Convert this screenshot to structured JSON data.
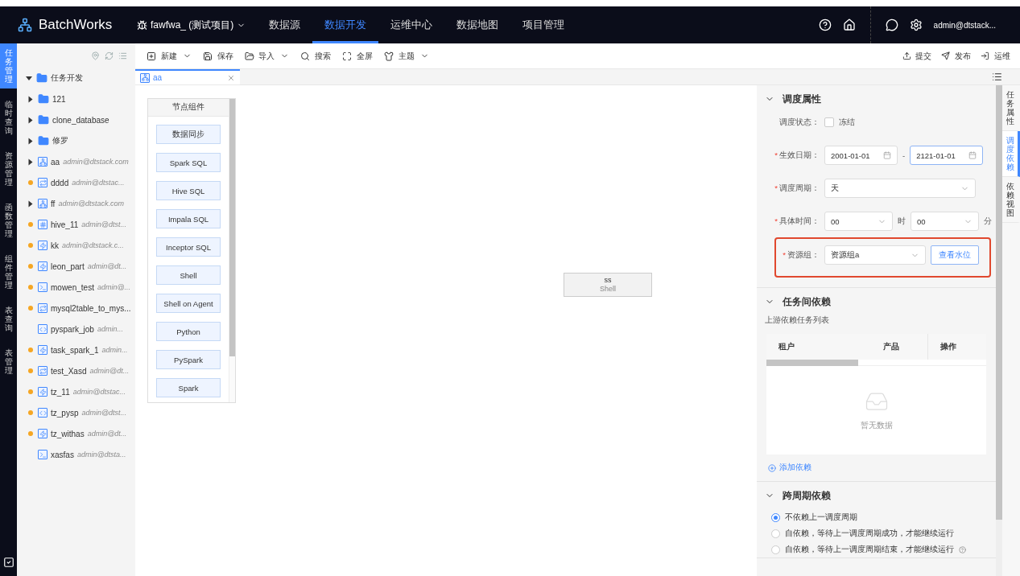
{
  "header": {
    "logo": "BatchWorks",
    "project": "fawfwa_ (测试项目)",
    "nav": [
      {
        "label": "数据源",
        "selected": false
      },
      {
        "label": "数据开发",
        "selected": true
      },
      {
        "label": "运维中心",
        "selected": false
      },
      {
        "label": "数据地图",
        "selected": false
      },
      {
        "label": "项目管理",
        "selected": false
      }
    ],
    "user": "admin@dtstack..."
  },
  "rail": [
    {
      "label": "任务管理",
      "selected": true
    },
    {
      "label": "临时查询",
      "selected": false
    },
    {
      "label": "资源管理",
      "selected": false
    },
    {
      "label": "函数管理",
      "selected": false
    },
    {
      "label": "组件管理",
      "selected": false
    },
    {
      "label": "表查询",
      "selected": false
    },
    {
      "label": "表管理",
      "selected": false
    }
  ],
  "tree": {
    "label": "任务开发",
    "expanded": true,
    "children": [
      {
        "kind": "folder",
        "label": "121",
        "expanded": false
      },
      {
        "kind": "folder",
        "label": "clone_database",
        "expanded": false
      },
      {
        "kind": "folder",
        "label": "修罗",
        "expanded": false
      },
      {
        "kind": "workflow",
        "label": "aa",
        "owner": "admin@dtstack.com",
        "expanded": false
      },
      {
        "kind": "sync",
        "label": "dddd",
        "owner": "admin@dtstac...",
        "dot": true
      },
      {
        "kind": "workflow",
        "label": "ff",
        "owner": "admin@dtstack.com",
        "expanded": false
      },
      {
        "kind": "hive",
        "label": "hive_11",
        "owner": "admin@dtst...",
        "dot": true
      },
      {
        "kind": "spark",
        "label": "kk",
        "owner": "admin@dtstack.c...",
        "dot": true
      },
      {
        "kind": "spark",
        "label": "leon_part",
        "owner": "admin@dt...",
        "dot": true
      },
      {
        "kind": "shell",
        "label": "mowen_test",
        "owner": "admin@...",
        "dot": true
      },
      {
        "kind": "sync",
        "label": "mysql2table_to_mys...",
        "dot": true
      },
      {
        "kind": "pyspark",
        "label": "pyspark_job",
        "owner": "admin...",
        "dot": false
      },
      {
        "kind": "spark",
        "label": "task_spark_1",
        "owner": "admin...",
        "dot": true
      },
      {
        "kind": "sync",
        "label": "test_Xasd",
        "owner": "admin@dt...",
        "dot": true
      },
      {
        "kind": "spark",
        "label": "tz_11",
        "owner": "admin@dtstac...",
        "dot": true
      },
      {
        "kind": "pyspark",
        "label": "tz_pysp",
        "owner": "admin@dtst...",
        "dot": true
      },
      {
        "kind": "spark",
        "label": "tz_withas",
        "owner": "admin@dt...",
        "dot": true
      },
      {
        "kind": "shell",
        "label": "xasfas",
        "owner": "admin@dtsta...",
        "dot": false
      }
    ]
  },
  "toolbar": {
    "left": [
      {
        "label": "新建",
        "menu": true
      },
      {
        "label": "保存",
        "menu": false
      },
      {
        "label": "导入",
        "menu": true
      },
      {
        "label": "搜索",
        "menu": false
      },
      {
        "label": "全屏",
        "menu": false
      },
      {
        "label": "主题",
        "menu": true
      }
    ],
    "right": [
      {
        "label": "提交"
      },
      {
        "label": "发布"
      },
      {
        "label": "运维"
      }
    ]
  },
  "tabs": [
    {
      "label": "aa",
      "selected": true
    }
  ],
  "node_panel": {
    "title": "节点组件",
    "items": [
      "数据同步",
      "Spark SQL",
      "Hive SQL",
      "Impala SQL",
      "Inceptor SQL",
      "Shell",
      "Shell on Agent",
      "Python",
      "PySpark",
      "Spark"
    ]
  },
  "canvas": {
    "nodes": [
      {
        "name": "ss",
        "type": "Shell"
      }
    ]
  },
  "properties": {
    "schedule": {
      "title": "调度属性",
      "expanded": true,
      "status_label": "调度状态：",
      "frozen_label": "冻结",
      "frozen": false,
      "date_mark": "*",
      "period_mark": "*",
      "time_mark": "*",
      "group_mark": "*",
      "date_label": "生效日期：",
      "date_start": "2001-01-01",
      "date_end": "2121-01-01",
      "date_sep": "-",
      "period_label": "调度周期：",
      "period": "天",
      "time_label": "具体时间：",
      "hour": "00",
      "hour_unit": "时",
      "minute": "00",
      "minute_unit": "分",
      "group_label": "资源组：",
      "group": "资源组a",
      "group_button": "查看水位",
      "group_highlighted": true
    },
    "deps": {
      "title": "任务间依赖",
      "expanded": true,
      "subtitle": "上游依赖任务列表",
      "columns": [
        "租户",
        "产品",
        "操作"
      ],
      "empty": "暂无数据",
      "add": "添加依赖"
    },
    "cross": {
      "title": "跨周期依赖",
      "expanded": true,
      "options": [
        {
          "label": "不依赖上一调度周期",
          "selected": true,
          "help": false
        },
        {
          "label": "自依赖，等待上一调度周期成功，才能继续运行",
          "selected": false,
          "help": false
        },
        {
          "label": "自依赖，等待上一调度周期结束，才能继续运行",
          "selected": false,
          "help": true
        }
      ]
    }
  },
  "side_tabs": [
    {
      "label": "任务属性",
      "selected": false
    },
    {
      "label": "调度依赖",
      "selected": true
    },
    {
      "label": "依赖视图",
      "selected": false
    }
  ]
}
